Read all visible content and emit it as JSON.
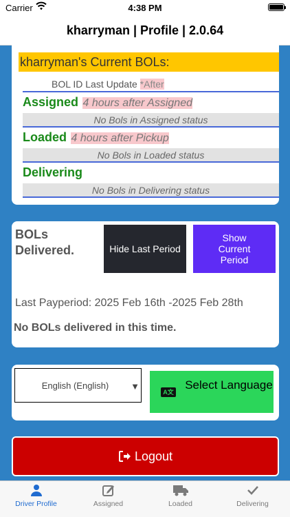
{
  "status_bar": {
    "carrier": "Carrier",
    "time": "4:38 PM"
  },
  "nav": {
    "title": "kharryman | Profile | 2.0.64"
  },
  "current_bols": {
    "header": "kharryman's Current BOLs:",
    "column_header_prefix": "BOL ID Last Update ",
    "column_header_after": "*After",
    "sections": [
      {
        "title": "Assigned",
        "note": "4 hours after Assigned",
        "empty": "No Bols in Assigned status"
      },
      {
        "title": "Loaded",
        "note": "4 hours after Pickup",
        "empty": "No Bols in Loaded status"
      },
      {
        "title": "Delivering",
        "note": "",
        "empty": "No Bols in Delivering status"
      }
    ]
  },
  "delivered": {
    "title": "BOLs Delivered.",
    "hide_button": "Hide Last Period",
    "show_button": "Show Current Period",
    "payperiod": "Last Payperiod: 2025 Feb 16th -2025 Feb 28th",
    "none_message": "No BOLs delivered in this time."
  },
  "language": {
    "selected": "English (English)",
    "button": "Select Language"
  },
  "logout": {
    "label": "Logout"
  },
  "tabs": [
    {
      "label": "Driver Profile",
      "icon": "person-icon",
      "active": true
    },
    {
      "label": "Assigned",
      "icon": "edit-icon",
      "active": false
    },
    {
      "label": "Loaded",
      "icon": "truck-icon",
      "active": false
    },
    {
      "label": "Delivering",
      "icon": "check-icon",
      "active": false
    }
  ],
  "colors": {
    "accent": "#1f6bd0",
    "header_bg": "#ffc600",
    "green_text": "#1a8a1a",
    "logout": "#cc0000",
    "purple": "#5e2cf5",
    "select_language": "#2bd65a",
    "background": "#2f81c4"
  }
}
